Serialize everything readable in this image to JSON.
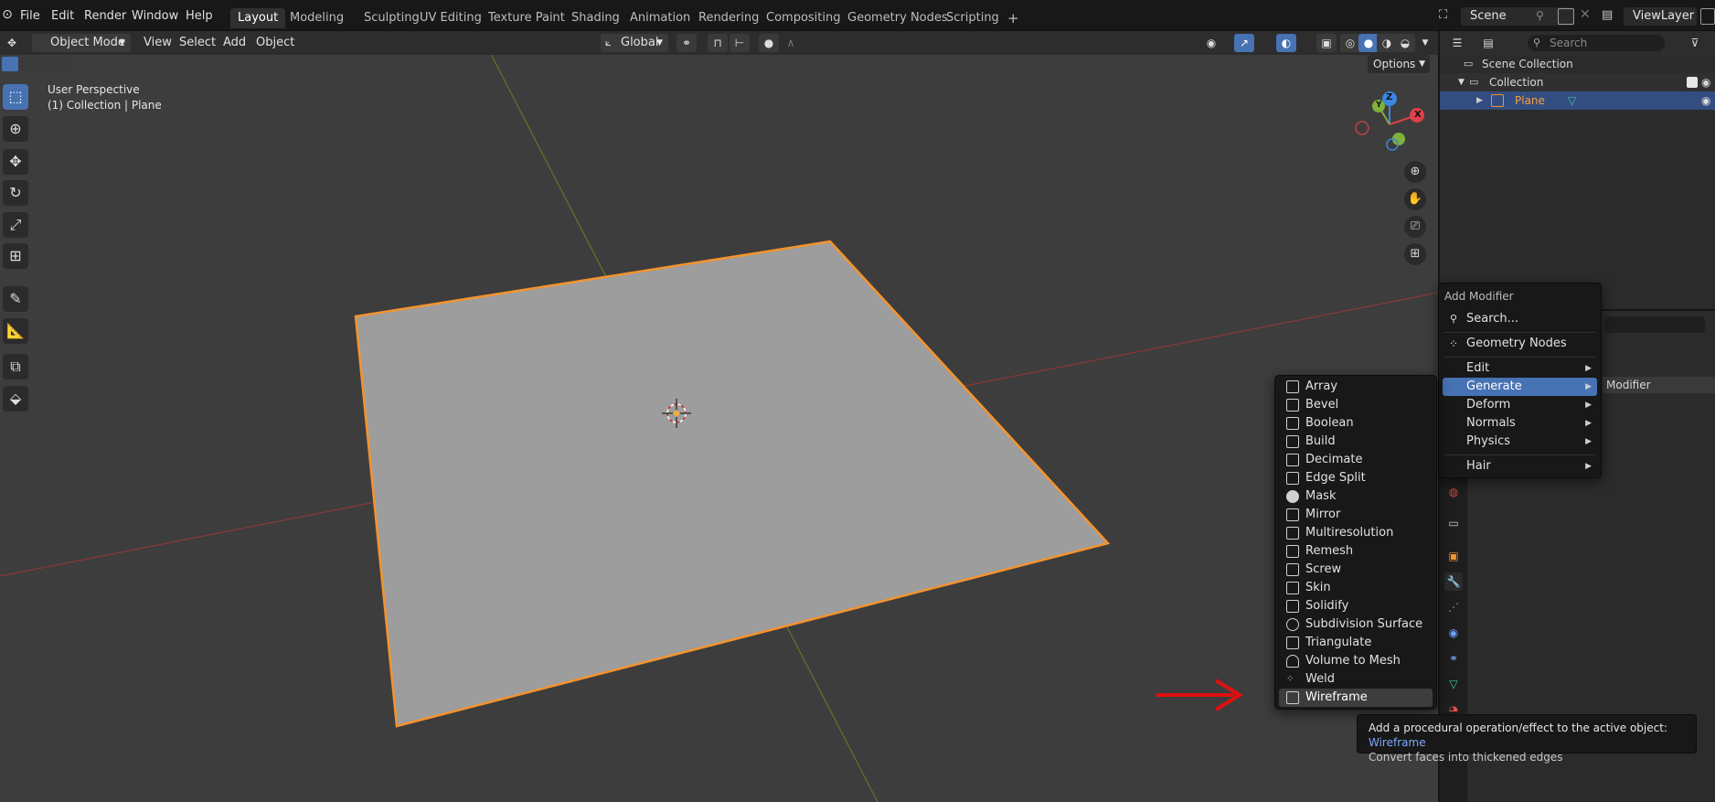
{
  "topbar": {
    "menus": [
      "File",
      "Edit",
      "Render",
      "Window",
      "Help"
    ],
    "workspaces": [
      "Layout",
      "Modeling",
      "Sculpting",
      "UV Editing",
      "Texture Paint",
      "Shading",
      "Animation",
      "Rendering",
      "Compositing",
      "Geometry Nodes",
      "Scripting"
    ],
    "active_workspace": "Layout",
    "add_tab": "+",
    "scene": "Scene",
    "view_layer": "ViewLayer"
  },
  "viewport_header": {
    "mode": "Object Mode",
    "menus": [
      "View",
      "Select",
      "Add",
      "Object"
    ],
    "orientation": "Global",
    "options": "Options"
  },
  "overlay": {
    "perspective": "User Perspective",
    "collection_info": "(1) Collection | Plane"
  },
  "gizmo": {
    "z": "Z",
    "y": "Y",
    "x": "X"
  },
  "outliner": {
    "search_placeholder": "Search",
    "scene_collection": "Scene Collection",
    "collection": "Collection",
    "object": "Plane"
  },
  "properties": {
    "partial_label": "Modifier"
  },
  "add_modifier_menu": {
    "title": "Add Modifier",
    "search": "Search...",
    "geometry_nodes": "Geometry Nodes",
    "categories": [
      "Edit",
      "Generate",
      "Deform",
      "Normals",
      "Physics"
    ],
    "hair": "Hair",
    "active_category": "Generate"
  },
  "generate_menu": {
    "items": [
      "Array",
      "Bevel",
      "Boolean",
      "Build",
      "Decimate",
      "Edge Split",
      "Mask",
      "Mirror",
      "Multiresolution",
      "Remesh",
      "Screw",
      "Skin",
      "Solidify",
      "Subdivision Surface",
      "Triangulate",
      "Volume to Mesh",
      "Weld",
      "Wireframe"
    ],
    "highlighted": "Wireframe"
  },
  "tooltip": {
    "text": "Add a procedural operation/effect to the active object:",
    "highlight": "Wireframe",
    "description": "Convert faces into thickened edges"
  },
  "colors": {
    "accent": "#4772b3",
    "selection_outline": "#f5932f",
    "annotation_arrow": "#e01010",
    "x_axis": "#9a3c3c",
    "y_axis": "#5f7d2b"
  }
}
